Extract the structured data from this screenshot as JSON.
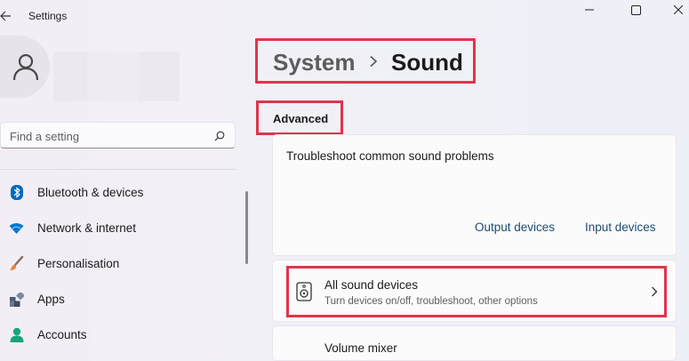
{
  "window": {
    "title": "Settings"
  },
  "search": {
    "placeholder": "Find a setting"
  },
  "sidebar": {
    "items": [
      {
        "label": "Bluetooth & devices",
        "icon": "bluetooth-icon",
        "color": "#0067c0"
      },
      {
        "label": "Network & internet",
        "icon": "wifi-icon",
        "color": "#0078d4"
      },
      {
        "label": "Personalisation",
        "icon": "brush-icon",
        "color": "#e8873a"
      },
      {
        "label": "Apps",
        "icon": "apps-icon",
        "color": "#4a5a73"
      },
      {
        "label": "Accounts",
        "icon": "accounts-icon",
        "color": "#1aa37a"
      }
    ]
  },
  "breadcrumb": {
    "parent": "System",
    "current": "Sound"
  },
  "section": {
    "title": "Advanced"
  },
  "troubleshoot": {
    "title": "Troubleshoot common sound problems",
    "links": [
      "Output devices",
      "Input devices"
    ]
  },
  "all_sound_devices": {
    "title": "All sound devices",
    "subtitle": "Turn devices on/off, troubleshoot, other options"
  },
  "volume_mixer": {
    "label": "Volume mixer"
  },
  "colors": {
    "highlight": "#e0344a",
    "link": "#1f4b6e",
    "accent": "#0067c0"
  }
}
